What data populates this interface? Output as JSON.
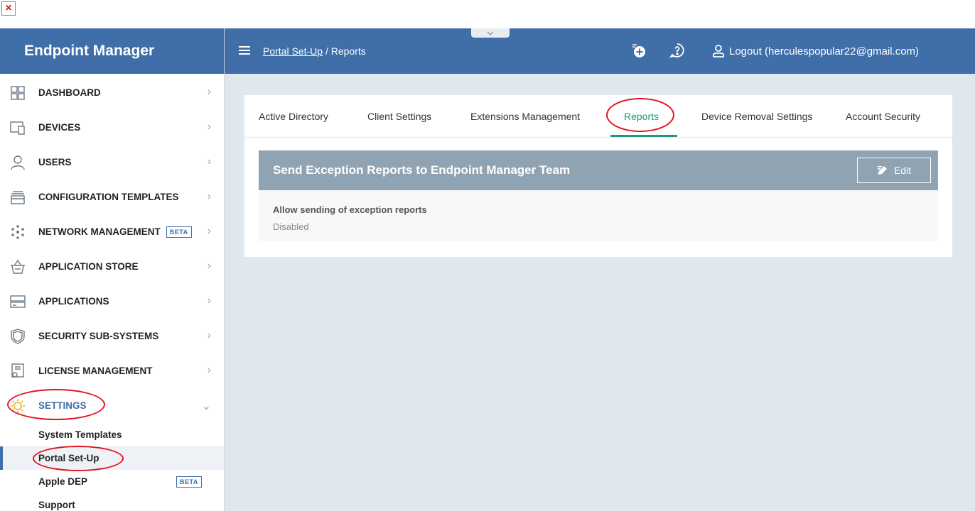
{
  "window": {
    "close_glyph": "×"
  },
  "sidebar": {
    "brand": "Endpoint Manager",
    "items": [
      {
        "label": "DASHBOARD",
        "icon": "dashboard-icon"
      },
      {
        "label": "DEVICES",
        "icon": "devices-icon"
      },
      {
        "label": "USERS",
        "icon": "users-icon"
      },
      {
        "label": "CONFIGURATION TEMPLATES",
        "icon": "configuration-templates-icon"
      },
      {
        "label": "NETWORK MANAGEMENT",
        "icon": "network-icon",
        "badge": "BETA"
      },
      {
        "label": "APPLICATION STORE",
        "icon": "store-icon"
      },
      {
        "label": "APPLICATIONS",
        "icon": "applications-icon"
      },
      {
        "label": "SECURITY SUB-SYSTEMS",
        "icon": "shield-icon"
      },
      {
        "label": "LICENSE MANAGEMENT",
        "icon": "license-icon"
      },
      {
        "label": "SETTINGS",
        "icon": "settings-icon",
        "expanded": true
      }
    ],
    "sub_items": [
      {
        "label": "System Templates"
      },
      {
        "label": "Portal Set-Up",
        "active": true
      },
      {
        "label": "Apple DEP",
        "badge": "BETA"
      },
      {
        "label": "Support"
      }
    ]
  },
  "topbar": {
    "breadcrumb_link": "Portal Set-Up",
    "breadcrumb_separator": "/",
    "breadcrumb_current": "Reports",
    "logout_label": "Logout (herculespopular22@gmail.com)"
  },
  "tabs": [
    {
      "label": "Active Directory"
    },
    {
      "label": "Client Settings"
    },
    {
      "label": "Extensions Management"
    },
    {
      "label": "Reports",
      "active": true
    },
    {
      "label": "Device Removal Settings"
    },
    {
      "label": "Account Security"
    }
  ],
  "panel": {
    "title": "Send Exception Reports to Endpoint Manager Team",
    "edit_label": "Edit",
    "field_label": "Allow sending of exception reports",
    "field_value": "Disabled"
  },
  "colors": {
    "brand_blue": "#3f6ea8",
    "active_tab": "#1a9a7a",
    "panel_header": "#90a3b3",
    "highlight_ring": "#e0141e"
  }
}
